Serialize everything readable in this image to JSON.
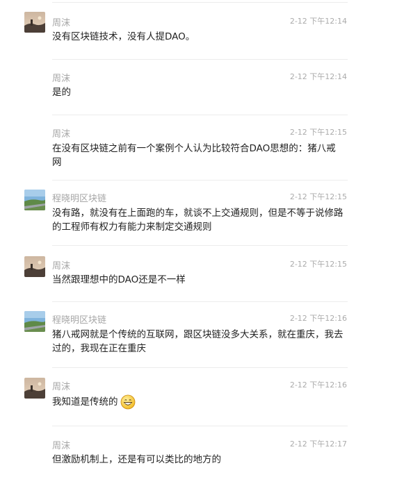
{
  "messages": [
    {
      "avatar": "dusk-landscape-avatar",
      "name": "周沫",
      "time": "2-12 下午12:14",
      "text": "没有区块链技术，没有人提DAO。"
    },
    {
      "avatar": "",
      "name": "周沫",
      "time": "2-12 下午12:14",
      "text": "是的"
    },
    {
      "avatar": "",
      "name": "周沫",
      "time": "2-12 下午12:15",
      "text": "在没有区块链之前有一个案例个人认为比较符合DAO思想的：猪八戒网"
    },
    {
      "avatar": "road-landscape-avatar",
      "name": "程晓明区块链",
      "time": "2-12 下午12:15",
      "text": "没有路，就没有在上面跑的车，就谈不上交通规则，但是不等于说修路的工程师有权力有能力来制定交通规则"
    },
    {
      "avatar": "dusk-landscape-avatar",
      "name": "周沫",
      "time": "2-12 下午12:15",
      "text": "当然跟理想中的DAO还是不一样"
    },
    {
      "avatar": "road-landscape-avatar",
      "name": "程晓明区块链",
      "time": "2-12 下午12:16",
      "text": "猪八戒网就是个传统的互联网，跟区块链没多大关系，就在重庆，我去过的，我现在正在重庆"
    },
    {
      "avatar": "dusk-landscape-avatar",
      "name": "周沫",
      "time": "2-12 下午12:16",
      "text": "我知道是传统的",
      "emoji": "grinning-face-icon"
    },
    {
      "avatar": "",
      "name": "周沫",
      "time": "2-12 下午12:17",
      "text": "但激励机制上，还是有可以类比的地方的"
    }
  ]
}
